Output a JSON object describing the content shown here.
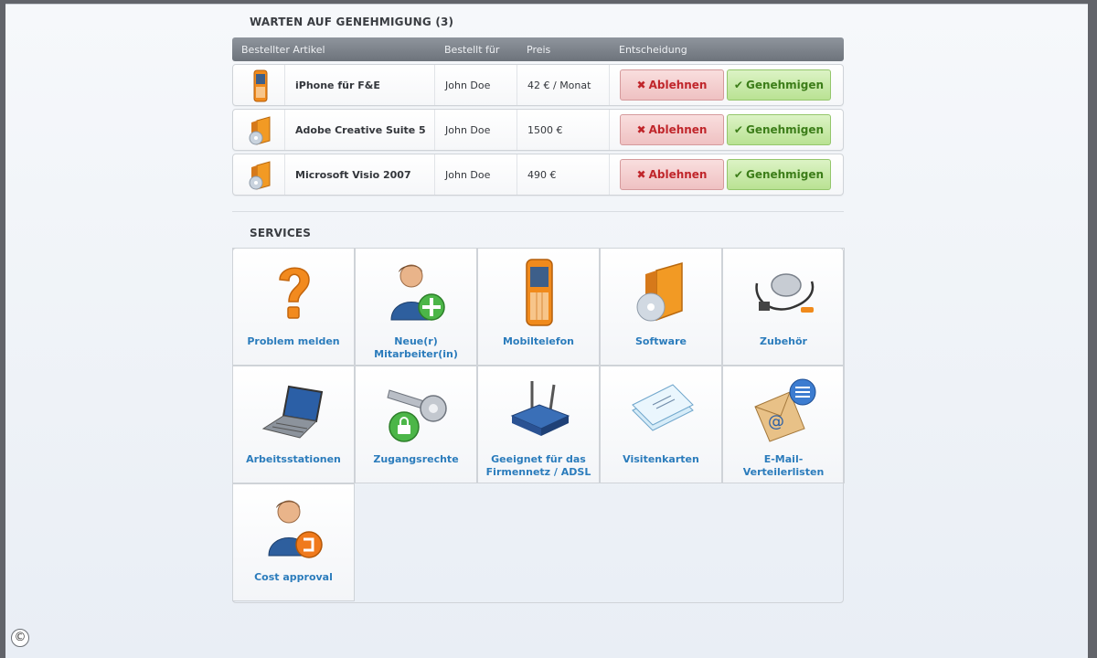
{
  "pending": {
    "title": "WARTEN AUF GENEHMIGUNG (3)",
    "columns": {
      "item": "Bestellter Artikel",
      "for": "Bestellt für",
      "price": "Preis",
      "decision": "Entscheidung"
    },
    "rows": [
      {
        "icon": "mobile-phone-icon",
        "name": "iPhone für F&E",
        "for": "John Doe",
        "price": "42 € / Monat",
        "reject": "Ablehnen",
        "approve": "Genehmigen"
      },
      {
        "icon": "software-box-icon",
        "name": "Adobe Creative Suite 5",
        "for": "John Doe",
        "price": "1500 €",
        "reject": "Ablehnen",
        "approve": "Genehmigen"
      },
      {
        "icon": "software-box-icon",
        "name": "Microsoft Visio 2007",
        "for": "John Doe",
        "price": "490 €",
        "reject": "Ablehnen",
        "approve": "Genehmigen"
      }
    ]
  },
  "services": {
    "title": "SERVICES",
    "tiles": [
      {
        "label": "Problem melden",
        "icon": "question-mark-icon"
      },
      {
        "label": "Neue(r) Mitarbeiter(in)",
        "icon": "add-user-icon"
      },
      {
        "label": "Mobiltelefon",
        "icon": "mobile-phone-icon"
      },
      {
        "label": "Software",
        "icon": "software-box-icon"
      },
      {
        "label": "Zubehör",
        "icon": "mouse-cable-icon"
      },
      {
        "label": "Arbeitsstationen",
        "icon": "laptop-icon"
      },
      {
        "label": "Zugangsrechte",
        "icon": "key-lock-icon"
      },
      {
        "label": "Geeignet für das Firmennetz / ADSL",
        "icon": "router-icon"
      },
      {
        "label": "Visitenkarten",
        "icon": "business-cards-icon"
      },
      {
        "label": "E-Mail-Verteilerlisten",
        "icon": "email-list-icon"
      },
      {
        "label": "Cost approval",
        "icon": "cost-approval-user-icon"
      }
    ]
  },
  "footer": {
    "copyright_symbol": "©"
  },
  "colors": {
    "reject": "#c0262b",
    "approve": "#3c7d19",
    "link": "#2b7cbc",
    "header": "#6d737b"
  }
}
